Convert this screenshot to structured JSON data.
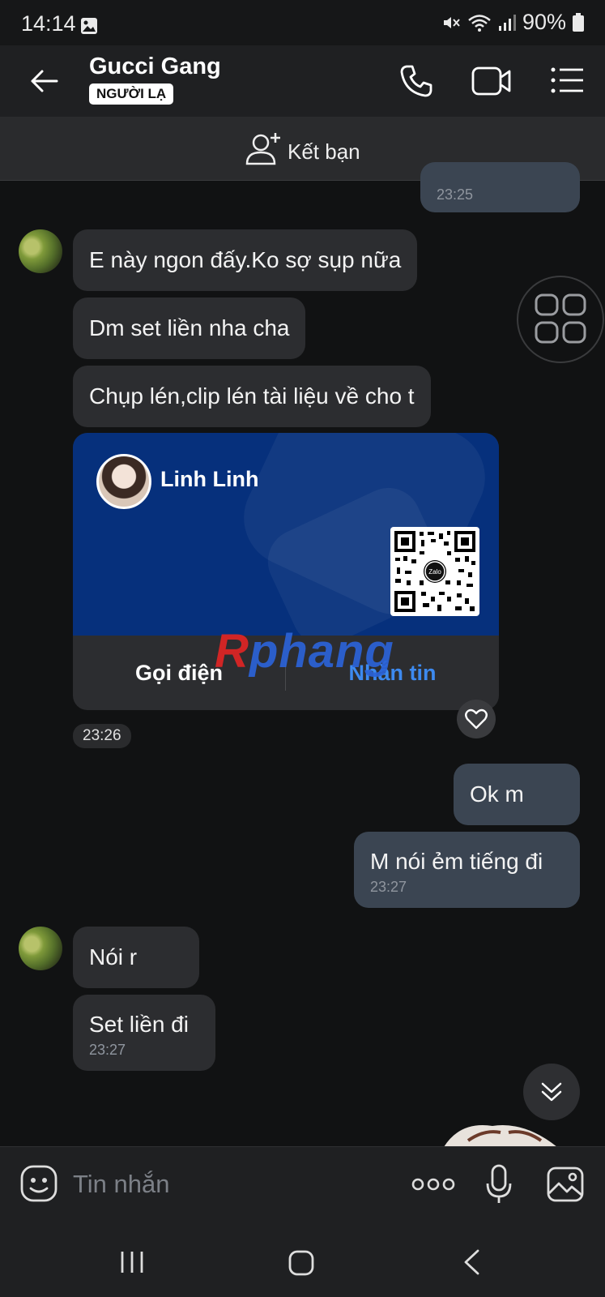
{
  "status_bar": {
    "time": "14:14",
    "battery": "90%"
  },
  "header": {
    "title": "Gucci Gang",
    "badge": "NGƯỜI LẠ",
    "add_friend_label": "Kết bạn"
  },
  "messages": [
    {
      "side": "out",
      "time": "23:25"
    },
    {
      "side": "in",
      "text": "E này ngon đấy.Ko sợ sụp nữa"
    },
    {
      "side": "in",
      "text": "Dm set liền nha cha"
    },
    {
      "side": "in",
      "text": "Chụp lén,clip lén tài liệu về cho t"
    },
    {
      "side": "out",
      "text": "Ok m"
    },
    {
      "side": "out",
      "text": "M nói ẻm tiếng đi",
      "time": "23:27"
    },
    {
      "side": "in",
      "text": "Nói r"
    },
    {
      "side": "in",
      "text": "Set liền đi",
      "time": "23:27"
    }
  ],
  "contact_card": {
    "name": "Linh Linh",
    "qr_badge": "Zalo",
    "call_label": "Gọi điện",
    "message_label": "Nhắn tin",
    "time": "23:26"
  },
  "watermark": {
    "letter": "R",
    "rest": "phang"
  },
  "input_bar": {
    "placeholder": "Tin nhắn"
  },
  "colors": {
    "background": "#111213",
    "incoming_bubble": "#2c2d30",
    "outgoing_bubble": "#3b4552",
    "card_blue": "#06307c",
    "link_blue": "#3d8af0"
  },
  "icons": [
    "back-arrow-icon",
    "phone-icon",
    "video-icon",
    "menu-icon",
    "add-friend-icon",
    "grid-icon",
    "heart-icon",
    "double-chevron-down-icon",
    "sticker-icon",
    "more-icon",
    "mic-icon",
    "image-icon",
    "recent-apps-icon",
    "home-icon",
    "back-nav-icon"
  ]
}
